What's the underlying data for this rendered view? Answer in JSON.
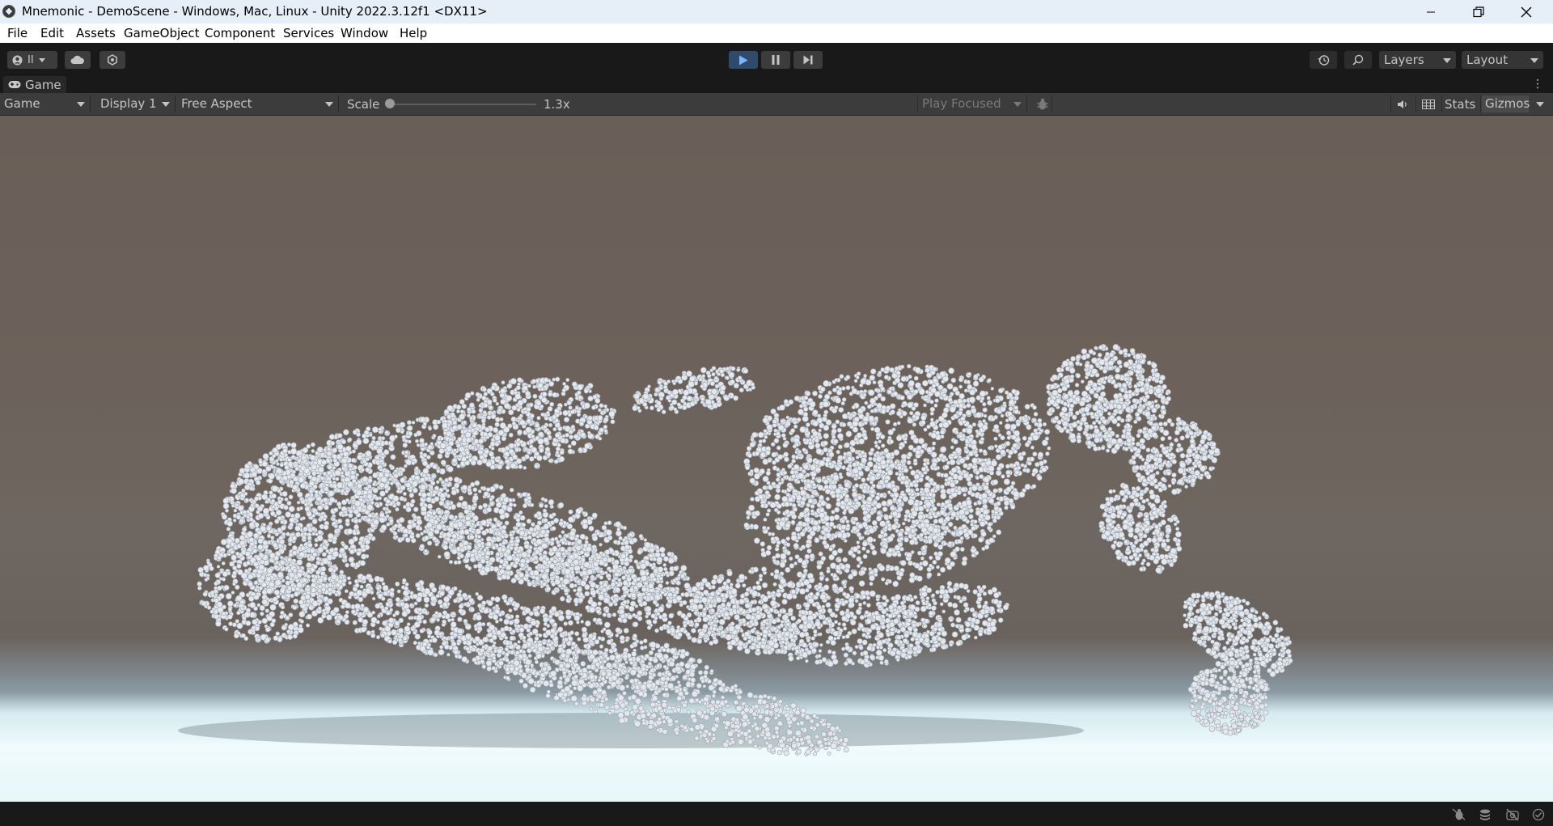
{
  "window": {
    "title": "Mnemonic - DemoScene - Windows, Mac, Linux - Unity 2022.3.12f1 <DX11>",
    "icon": "unity-icon",
    "controls": [
      "minimize-icon",
      "restore-icon",
      "close-icon"
    ]
  },
  "menu": {
    "items": [
      "File",
      "Edit",
      "Assets",
      "GameObject",
      "Component",
      "Services",
      "Window",
      "Help"
    ]
  },
  "toolbar": {
    "account_label": "II",
    "account_icon": "account-icon",
    "cloud_icon": "cloud-icon",
    "settings_icon": "services-gear-icon",
    "play_icon": "play-icon",
    "pause_icon": "pause-icon",
    "step_icon": "step-icon",
    "history_icon": "history-icon",
    "search_icon": "search-icon",
    "layers_label": "Layers",
    "layout_label": "Layout",
    "play_active_color": "#2f4a6a"
  },
  "tab": {
    "icon": "gamepad-icon",
    "label": "Game",
    "menu_icon": "kebab-menu-icon"
  },
  "game_toolbar": {
    "view_mode": "Game",
    "display": "Display 1",
    "aspect": "Free Aspect",
    "scale_label": "Scale",
    "scale_value": "1.3x",
    "play_mode": "Play Focused",
    "bug_icon": "bug-icon",
    "audio_icon": "speaker-icon",
    "grid_icon": "grid-icon",
    "stats_label": "Stats",
    "gizmos_label": "Gizmos"
  },
  "viewport": {
    "sky_color": "#6a5f58",
    "ground_color": "#e6f6f8",
    "point_color": "#e4e8ee"
  },
  "status_icons": [
    "debug-off-icon",
    "stack-icon",
    "camera-off-icon",
    "check-circle-icon"
  ]
}
